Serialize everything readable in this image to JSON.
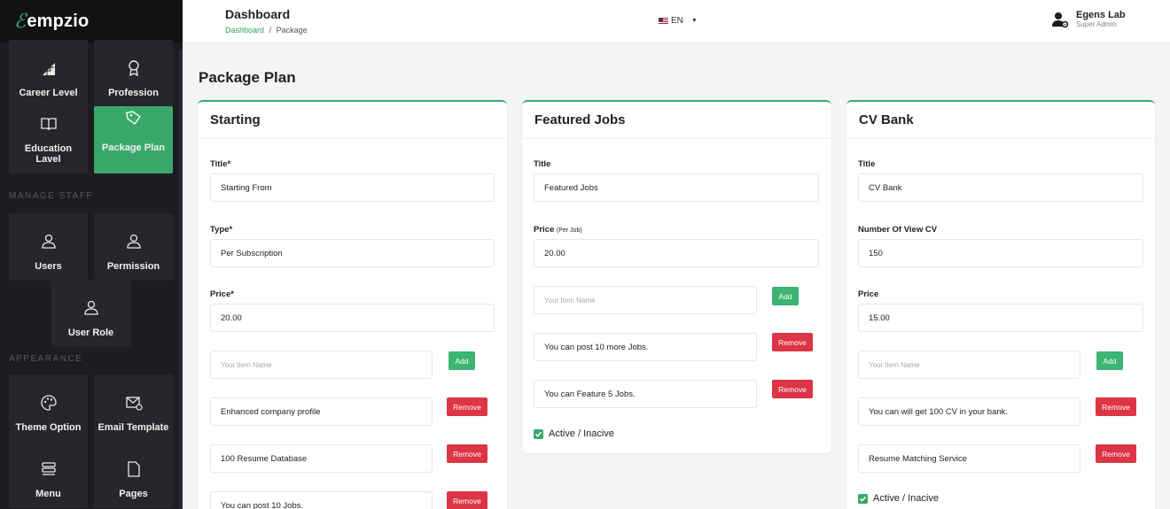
{
  "brand": {
    "logo_mark": "ℰ",
    "name": "empzio"
  },
  "sidebar": {
    "sections": {
      "manage_staff": "MANAGE STAFF",
      "appearance": "APPEARANCE"
    },
    "items": [
      {
        "label": "Career Level",
        "icon": "stairs-icon"
      },
      {
        "label": "Profession",
        "icon": "award-icon"
      },
      {
        "label": "Education Lavel",
        "icon": "book-icon"
      },
      {
        "label": "Package Plan",
        "icon": "tag-icon",
        "active": true
      },
      {
        "label": "Users",
        "icon": "user-icon"
      },
      {
        "label": "Permission",
        "icon": "user-icon"
      },
      {
        "label": "User Role",
        "icon": "user-icon"
      },
      {
        "label": "Theme Option",
        "icon": "palette-icon"
      },
      {
        "label": "Email Template",
        "icon": "mail-settings-icon"
      },
      {
        "label": "Menu",
        "icon": "menu-icon"
      },
      {
        "label": "Pages",
        "icon": "page-icon"
      }
    ]
  },
  "header": {
    "title": "Dashboard",
    "breadcrumb": {
      "home": "Dashboard",
      "sep": "/",
      "current": "Package"
    },
    "language": "EN",
    "user": {
      "name": "Egens Lab",
      "role": "Super Admin"
    }
  },
  "main": {
    "page_title": "Package Plan",
    "add_label": "Add",
    "remove_label": "Remove",
    "item_placeholder": "Your Item Name",
    "active_label": "Active / Inacive",
    "cards": [
      {
        "title": "Starting",
        "fields": [
          {
            "label": "Title*",
            "value": "Starting From"
          },
          {
            "label": "Type*",
            "value": "Per Subscription"
          },
          {
            "label": "Price*",
            "value": "20.00"
          }
        ],
        "items": [
          "Enhanced company profile",
          "100 Resume Database",
          "You can post 10 Jobs."
        ]
      },
      {
        "title": "Featured Jobs",
        "fields": [
          {
            "label": "Title",
            "value": "Featured Jobs"
          },
          {
            "label": "Price",
            "note": "(Per Job)",
            "value": "20.00"
          }
        ],
        "items": [
          "You can post 10 more Jobs.",
          "You can Feature 5 Jobs."
        ],
        "active": true
      },
      {
        "title": "CV Bank",
        "fields": [
          {
            "label": "Title",
            "value": "CV Bank"
          },
          {
            "label": "Number Of View CV",
            "value": "150"
          },
          {
            "label": "Price",
            "value": "15.00"
          }
        ],
        "items": [
          "You can will get 100 CV in your bank.",
          "Resume Matching Service"
        ],
        "active": true
      }
    ]
  },
  "colors": {
    "accent": "#3aa86b",
    "danger": "#dc3545",
    "sidebar_bg": "#1c1d20"
  }
}
